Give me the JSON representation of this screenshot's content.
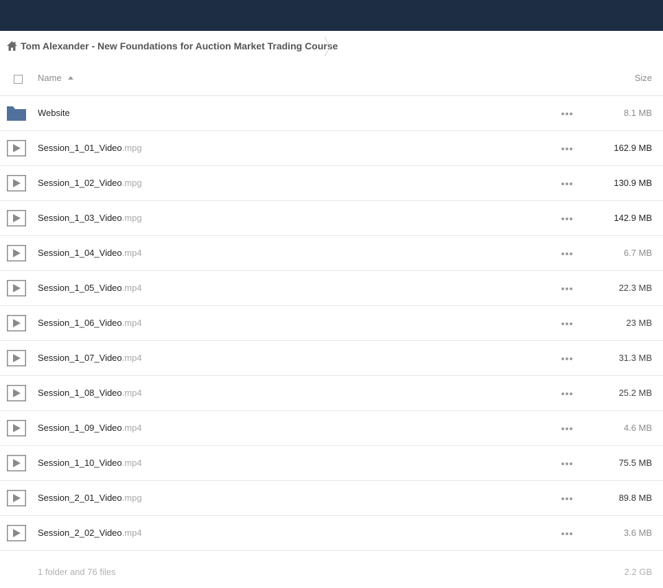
{
  "breadcrumb": {
    "home_icon": "home-icon",
    "current": "Tom Alexander - New Foundations for Auction Market Trading Course"
  },
  "table": {
    "header": {
      "name_label": "Name",
      "size_label": "Size",
      "sort_icon": "sort-ascending-icon"
    },
    "rows": [
      {
        "type": "folder",
        "icon": "folder-icon",
        "name": "Website",
        "ext": "",
        "size": "8.1 MB",
        "size_color": "#8b8b8b"
      },
      {
        "type": "video",
        "icon": "video-icon",
        "name": "Session_1_01_Video",
        "ext": ".mpg",
        "size": "162.9 MB",
        "size_color": "#222222"
      },
      {
        "type": "video",
        "icon": "video-icon",
        "name": "Session_1_02_Video",
        "ext": ".mpg",
        "size": "130.9 MB",
        "size_color": "#222222"
      },
      {
        "type": "video",
        "icon": "video-icon",
        "name": "Session_1_03_Video",
        "ext": ".mpg",
        "size": "142.9 MB",
        "size_color": "#222222"
      },
      {
        "type": "video",
        "icon": "video-icon",
        "name": "Session_1_04_Video",
        "ext": ".mp4",
        "size": "6.7 MB",
        "size_color": "#8b8b8b"
      },
      {
        "type": "video",
        "icon": "video-icon",
        "name": "Session_1_05_Video",
        "ext": ".mp4",
        "size": "22.3 MB",
        "size_color": "#444444"
      },
      {
        "type": "video",
        "icon": "video-icon",
        "name": "Session_1_06_Video",
        "ext": ".mp4",
        "size": "23 MB",
        "size_color": "#444444"
      },
      {
        "type": "video",
        "icon": "video-icon",
        "name": "Session_1_07_Video",
        "ext": ".mp4",
        "size": "31.3 MB",
        "size_color": "#444444"
      },
      {
        "type": "video",
        "icon": "video-icon",
        "name": "Session_1_08_Video",
        "ext": ".mp4",
        "size": "25.2 MB",
        "size_color": "#444444"
      },
      {
        "type": "video",
        "icon": "video-icon",
        "name": "Session_1_09_Video",
        "ext": ".mp4",
        "size": "4.6 MB",
        "size_color": "#8b8b8b"
      },
      {
        "type": "video",
        "icon": "video-icon",
        "name": "Session_1_10_Video",
        "ext": ".mp4",
        "size": "75.5 MB",
        "size_color": "#333333"
      },
      {
        "type": "video",
        "icon": "video-icon",
        "name": "Session_2_01_Video",
        "ext": ".mpg",
        "size": "89.8 MB",
        "size_color": "#333333"
      },
      {
        "type": "video",
        "icon": "video-icon",
        "name": "Session_2_02_Video",
        "ext": ".mp4",
        "size": "3.6 MB",
        "size_color": "#8b8b8b"
      }
    ]
  },
  "footer": {
    "summary": "1 folder and 76 files",
    "total": "2.2 GB"
  },
  "colors": {
    "topbar": "#1d2d44",
    "folder": "#51719c",
    "accent_text": "#222222",
    "muted_text": "#8b8b8b"
  }
}
